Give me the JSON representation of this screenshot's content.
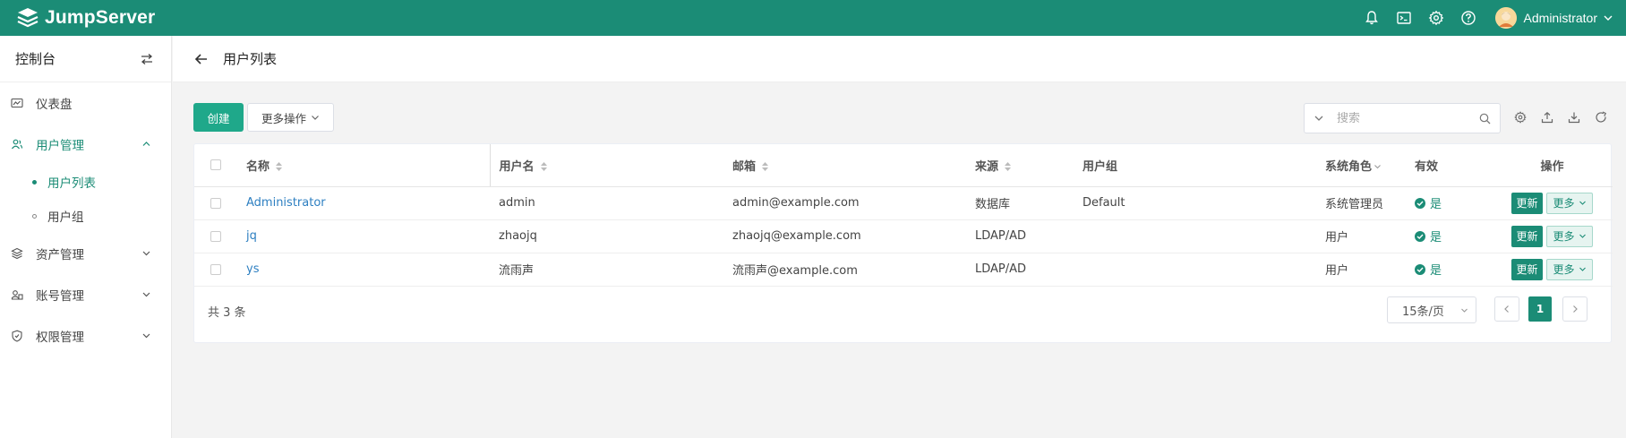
{
  "app": {
    "brand": "JumpServer"
  },
  "user": {
    "name": "Administrator"
  },
  "topbar_icons": [
    "bell-icon",
    "terminal-icon",
    "gear-icon",
    "help-icon"
  ],
  "sidebar": {
    "title": "控制台",
    "items": [
      {
        "label": "仪表盘",
        "icon": "dashboard-icon"
      },
      {
        "label": "用户管理",
        "icon": "users-icon",
        "expanded": true,
        "children": [
          {
            "label": "用户列表",
            "active": true
          },
          {
            "label": "用户组"
          }
        ]
      },
      {
        "label": "资产管理",
        "icon": "layers-icon"
      },
      {
        "label": "账号管理",
        "icon": "account-icon"
      },
      {
        "label": "权限管理",
        "icon": "shield-icon"
      }
    ]
  },
  "page": {
    "title": "用户列表"
  },
  "toolbar": {
    "create_label": "创建",
    "more_label": "更多操作",
    "search_placeholder": "搜索"
  },
  "table": {
    "columns": [
      "名称",
      "用户名",
      "邮箱",
      "来源",
      "用户组",
      "系统角色",
      "有效",
      "操作"
    ],
    "rows": [
      {
        "name": "Administrator",
        "username": "admin",
        "email": "admin@example.com",
        "source": "数据库",
        "group": "Default",
        "role": "系统管理员",
        "valid": "是"
      },
      {
        "name": "jq",
        "username": "zhaojq",
        "email": "zhaojq@example.com",
        "source": "LDAP/AD",
        "group": "",
        "role": "用户",
        "valid": "是"
      },
      {
        "name": "ys",
        "username": "流雨声",
        "email": "流雨声@example.com",
        "source": "LDAP/AD",
        "group": "",
        "role": "用户",
        "valid": "是"
      }
    ],
    "update_label": "更新",
    "more_label": "更多"
  },
  "pagination": {
    "total": "共 3 条",
    "page_size": "15条/页",
    "current_page": "1"
  },
  "colors": {
    "primary": "#1b8c76",
    "accent": "#1fa88a",
    "link": "#2d7fc1"
  }
}
